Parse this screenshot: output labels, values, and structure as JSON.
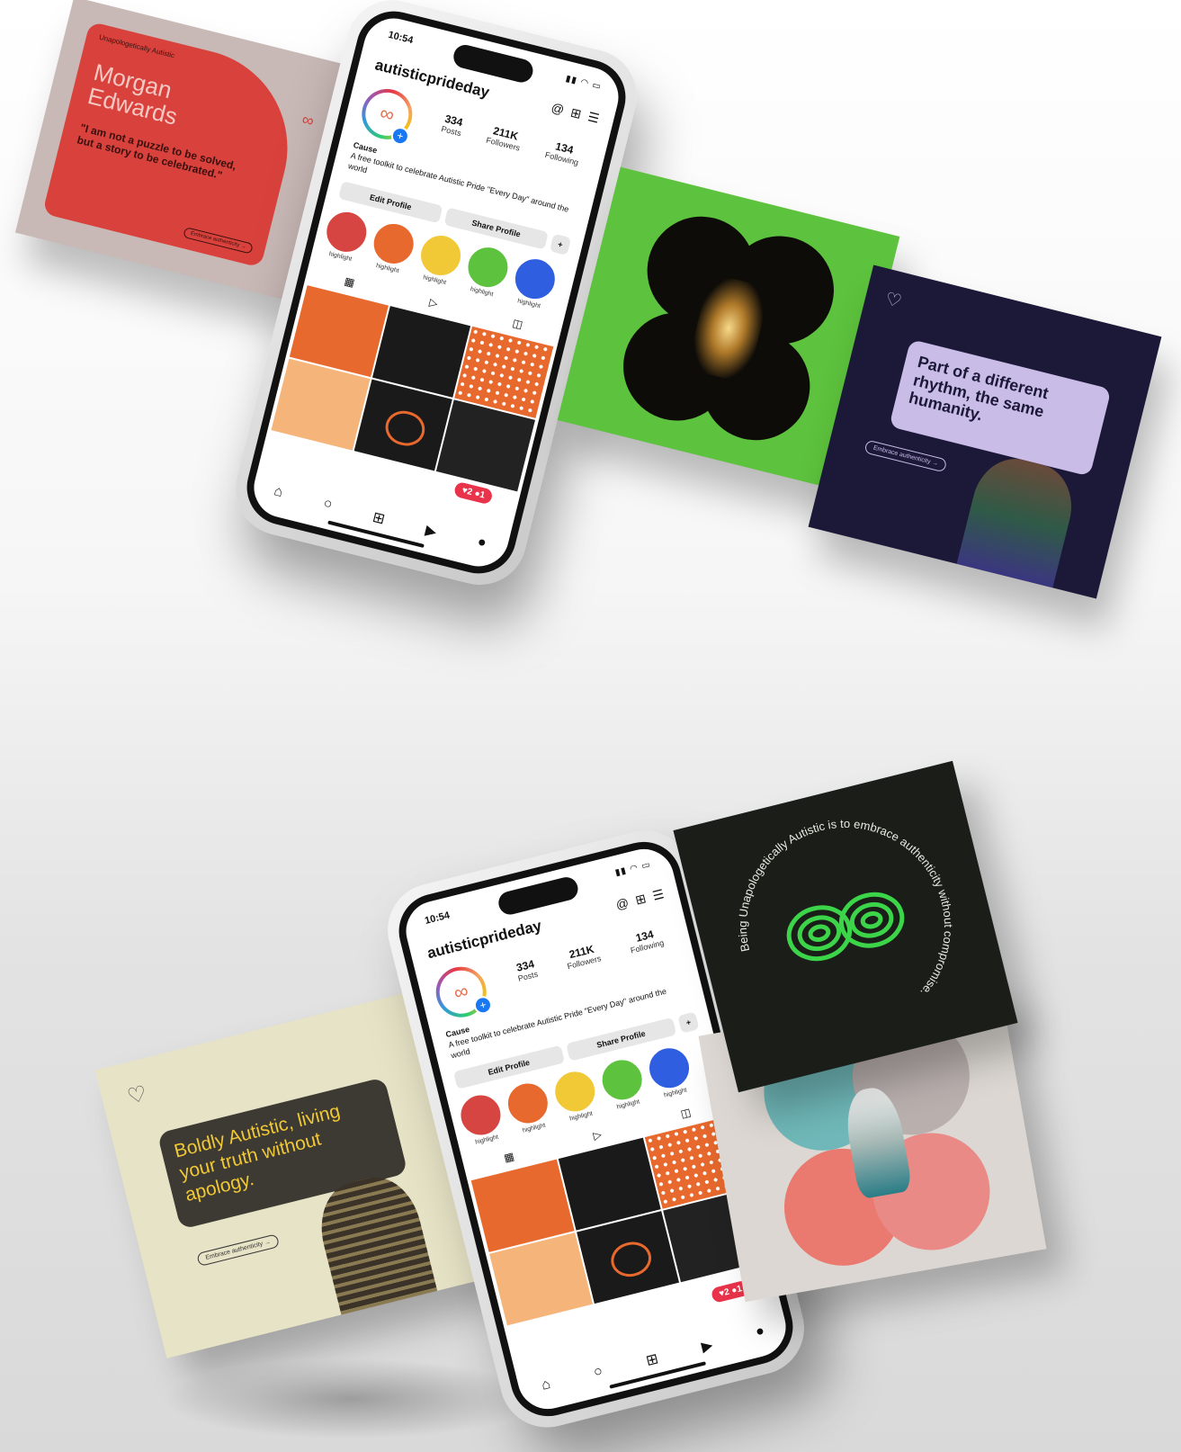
{
  "phone_top": {
    "time": "10:54",
    "handle": "autisticprideday",
    "stats": [
      {
        "num": "334",
        "label": "Posts"
      },
      {
        "num": "211K",
        "label": "Followers"
      },
      {
        "num": "134",
        "label": "Following"
      }
    ],
    "bio_category": "Cause",
    "bio_text": "A free toolkit to celebrate Autistic Pride \"Every Day\" around the world",
    "edit_label": "Edit Profile",
    "share_label": "Share Profile",
    "highlight_label": "highlight",
    "notification": "♥2  ●1"
  },
  "phone_bottom": {
    "time": "10:54",
    "handle": "autisticprideday",
    "stats": [
      {
        "num": "334",
        "label": "Posts"
      },
      {
        "num": "211K",
        "label": "Followers"
      },
      {
        "num": "134",
        "label": "Following"
      }
    ],
    "bio_category": "Cause",
    "bio_text": "A free toolkit to celebrate Autistic Pride \"Every Day\" around the world",
    "edit_label": "Edit Profile",
    "share_label": "Share Profile",
    "highlight_label": "highlight",
    "notification": "♥2  ●1"
  },
  "card_morgan": {
    "tag": "Unapologetically Autistic",
    "name": "Morgan Edwards",
    "quote": "\"I am not a puzzle to be solved, but a story to be celebrated.\"",
    "button": "Embrace authenticity →"
  },
  "card_rhythm": {
    "text": "Part of a different rhythm, the same humanity.",
    "button": "Embrace authenticity →"
  },
  "card_boldly": {
    "text": "Boldly Autistic, living your truth without apology.",
    "button": "Embrace authenticity →"
  },
  "card_circle": {
    "text": "Being Unapologetically Autistic is to embrace authenticity without compromise."
  },
  "colors": {
    "red": "#d64541",
    "orange": "#e8692d",
    "yellow": "#f1c836",
    "green": "#5dc23d",
    "blue": "#2f5fe0",
    "navy": "#1c1838",
    "lavender": "#c9bde8",
    "dark": "#1a1d18",
    "cream": "#e7e3c6"
  }
}
